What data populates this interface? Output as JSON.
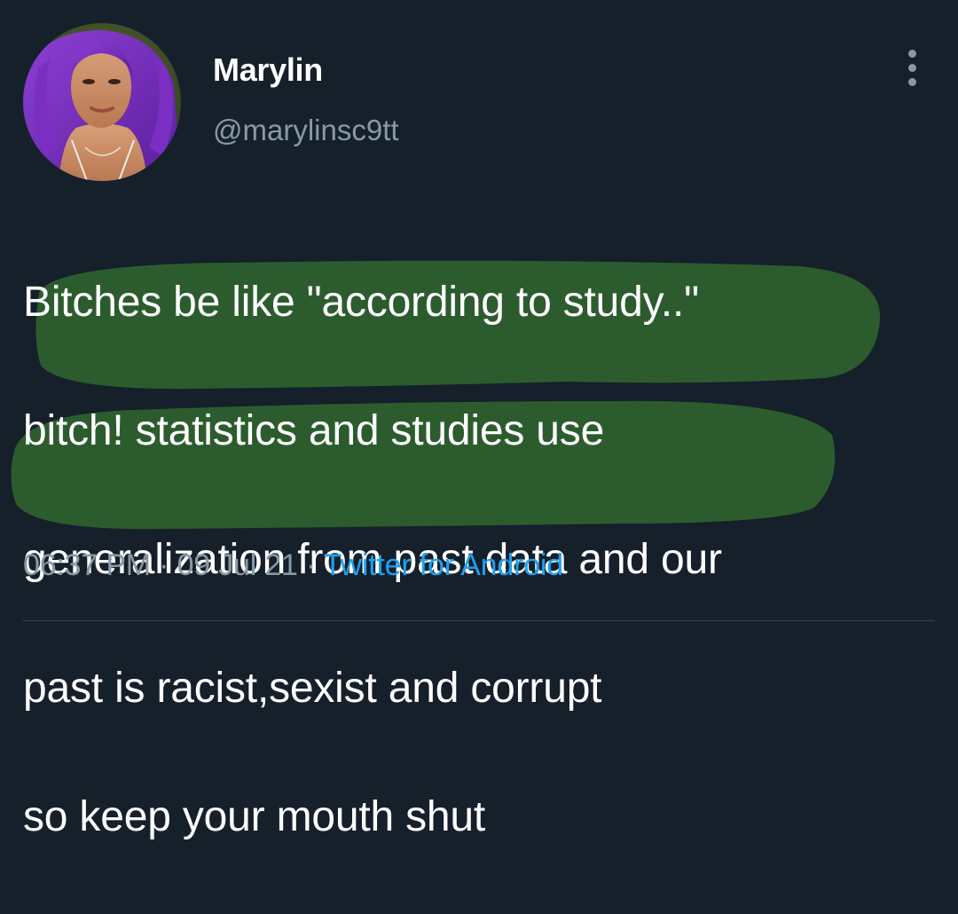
{
  "user": {
    "display_name": "Marylin",
    "handle": "@marylinsc9tt"
  },
  "tweet": {
    "lines": [
      "Bitches be like \"according to study..\"",
      "bitch! statistics and studies use",
      "generalization from past data and our",
      "past is racist,sexist and corrupt",
      "so keep your mouth shut"
    ],
    "time": "06:37 PM",
    "separator": " · ",
    "date": "09 Jul 21",
    "source": "Twitter for Android"
  },
  "icons": {
    "more": "more-vertical-icon"
  },
  "colors": {
    "background": "#15202b",
    "secondary_text": "#8899a6",
    "link": "#1da1f2",
    "highlight": "#2d5e2e"
  }
}
